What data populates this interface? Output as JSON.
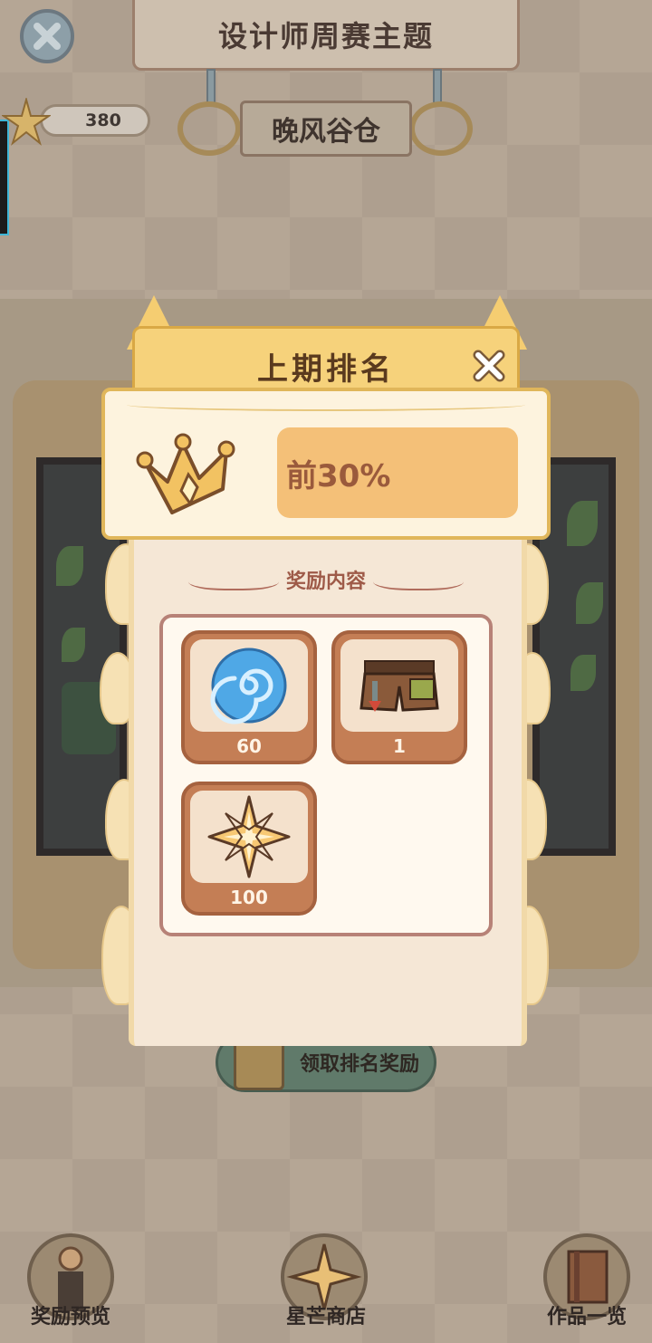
{
  "header": {
    "title": "设计师周赛主题",
    "theme_name": "晚风谷仓",
    "star_count": "380"
  },
  "popup": {
    "title": "上期排名",
    "rank_text": "前30%",
    "section_title": "奖励内容",
    "rewards": [
      {
        "icon": "blue-swirl-icon",
        "quantity": "60"
      },
      {
        "icon": "shorts-outfit-icon",
        "quantity": "1"
      },
      {
        "icon": "star-icon",
        "quantity": "100"
      }
    ]
  },
  "claim_button": {
    "label": "领取排名奖励"
  },
  "bottom_nav": [
    {
      "label": "奖励预览",
      "icon": "trophy-icon"
    },
    {
      "label": "星芒商店",
      "icon": "star-shop-icon"
    },
    {
      "label": "作品一览",
      "icon": "book-icon"
    }
  ],
  "colors": {
    "popup_header": "#f6d27b",
    "rank_highlight": "#f4c078",
    "reward_card": "#c47e55",
    "overlay_bg": "#b5a695"
  }
}
